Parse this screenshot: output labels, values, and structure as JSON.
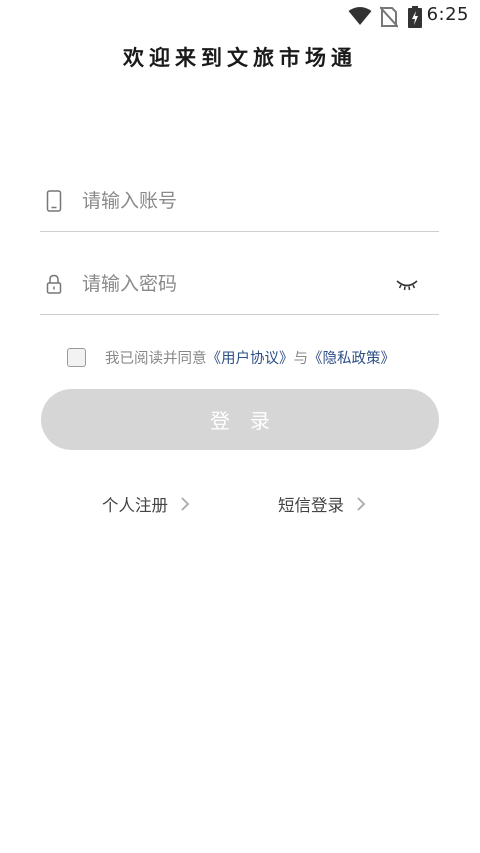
{
  "status_bar": {
    "time": "6:25",
    "icons": [
      "wifi-icon",
      "no-sim-icon",
      "battery-charging-icon"
    ]
  },
  "header": {
    "title": "欢迎来到文旅市场通"
  },
  "form": {
    "account": {
      "placeholder": "请输入账号",
      "icon": "phone-icon"
    },
    "password": {
      "placeholder": "请输入密码",
      "icon": "lock-icon",
      "toggle_icon": "eye-closed-icon"
    }
  },
  "agreement": {
    "checked": false,
    "prefix": "我已阅读并同意",
    "user_agreement": "《用户协议》",
    "conjunction": "与",
    "privacy_policy": "《隐私政策》"
  },
  "login_button": {
    "label": "登　录"
  },
  "links": {
    "register": "个人注册",
    "sms_login": "短信登录"
  },
  "colors": {
    "link": "#2f4f86",
    "button_disabled": "#d6d6d6",
    "placeholder": "#8a8a8a"
  }
}
